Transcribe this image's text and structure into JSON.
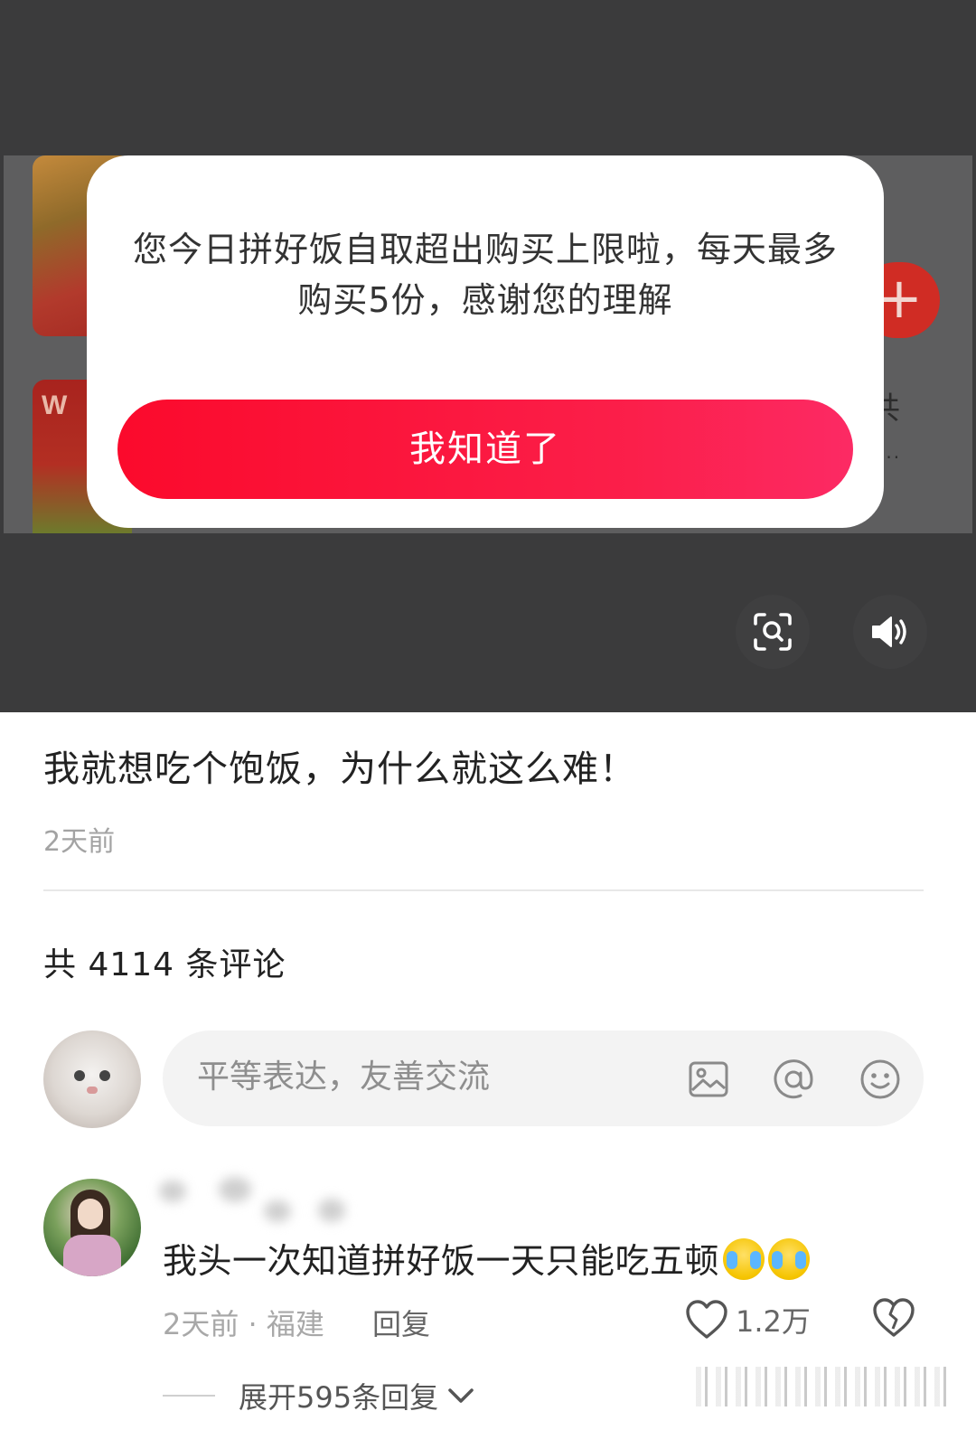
{
  "dialog": {
    "message": "您今日拼好饭自取超出购买上限啦，每天最多购买5份，感谢您的理解",
    "confirm_label": "我知道了"
  },
  "background_screen": {
    "product_tag_text": "W",
    "add_button_symbol": "+"
  },
  "media_controls": {
    "scan_icon": "lens-scan-icon",
    "volume_icon": "speaker-volume-icon"
  },
  "post": {
    "title": "我就想吃个饱饭，为什么就这么难！",
    "time": "2天前"
  },
  "comments": {
    "count_label": "共 4114 条评论",
    "composer": {
      "placeholder": "平等表达，友善交流",
      "icons": [
        "image-icon",
        "at-mention-icon",
        "emoji-smile-icon"
      ]
    },
    "items": [
      {
        "username": "",
        "text": "我头一次知道拼好饭一天只能吃五顿",
        "emojis": [
          "crying-laughing-emoji",
          "crying-laughing-emoji"
        ],
        "time_location": "2天前 · 福建",
        "reply_label": "回复",
        "like_count": "1.2万",
        "expand_label": "展开595条回复"
      }
    ]
  },
  "colors": {
    "dialog_button_start": "#fb0a2c",
    "dialog_button_end": "#fc2a64",
    "media_background": "#3b3b3c"
  }
}
